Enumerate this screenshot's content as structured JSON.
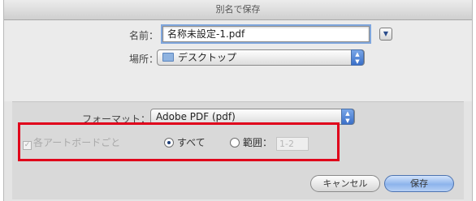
{
  "dialog": {
    "title": "別名で保存",
    "name_label": "名前：",
    "name_value": "名称未設定-1.pdf",
    "location_label": "場所：",
    "location_value": "デスクトップ",
    "format_label": "フォーマット：",
    "format_value": "Adobe PDF (pdf)",
    "each_artboard_label": "各アートボードごと",
    "all_label": "すべて",
    "range_label": "範囲：",
    "range_value": "1-2",
    "cancel_label": "キャンセル",
    "save_label": "保存"
  },
  "state": {
    "each_artboard_checked": true,
    "each_artboard_enabled": false,
    "selected_radio": "all"
  },
  "colors": {
    "highlight_box": "#e0001b",
    "default_button": "#8db4ec"
  },
  "icons": {
    "disclosure": "disclosure-triangle-icon",
    "folder": "folder-icon",
    "popup_arrows": "updown-arrows-icon"
  }
}
